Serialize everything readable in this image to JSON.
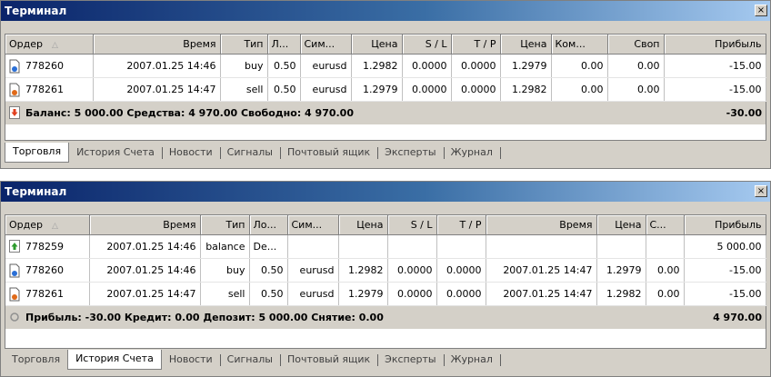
{
  "panel1": {
    "title": "Терминал",
    "close_glyph": "×",
    "headers": [
      "Ордер",
      "Время",
      "Тип",
      "Л...",
      "Сим...",
      "Цена",
      "S / L",
      "T / P",
      "Цена",
      "Ком...",
      "Своп",
      "Прибыль"
    ],
    "sort_glyph": "△",
    "rows": [
      {
        "order": "778260",
        "time": "2007.01.25 14:46",
        "type": "buy",
        "lots": "0.50",
        "symbol": "eurusd",
        "price": "1.2982",
        "sl": "0.0000",
        "tp": "0.0000",
        "price2": "1.2979",
        "commission": "0.00",
        "swap": "0.00",
        "profit": "-15.00"
      },
      {
        "order": "778261",
        "time": "2007.01.25 14:47",
        "type": "sell",
        "lots": "0.50",
        "symbol": "eurusd",
        "price": "1.2979",
        "sl": "0.0000",
        "tp": "0.0000",
        "price2": "1.2982",
        "commission": "0.00",
        "swap": "0.00",
        "profit": "-15.00"
      }
    ],
    "summary": {
      "text": "Баланс: 5 000.00  Средства: 4 970.00  Свободно: 4 970.00",
      "profit": "-30.00"
    },
    "tabs": [
      "Торговля",
      "История Счета",
      "Новости",
      "Сигналы",
      "Почтовый ящик",
      "Эксперты",
      "Журнал"
    ],
    "active_tab": "Торговля"
  },
  "panel2": {
    "title": "Терминал",
    "close_glyph": "×",
    "headers": [
      "Ордер",
      "Время",
      "Тип",
      "Ло...",
      "Сим...",
      "Цена",
      "S / L",
      "T / P",
      "Время",
      "Цена",
      "С...",
      "Прибыль"
    ],
    "sort_glyph": "△",
    "rows": [
      {
        "order": "778259",
        "time": "2007.01.25 14:46",
        "type": "balance",
        "lots": "De...",
        "symbol": "",
        "price": "",
        "sl": "",
        "tp": "",
        "close_time": "",
        "close_price": "",
        "swap": "",
        "profit": "5 000.00"
      },
      {
        "order": "778260",
        "time": "2007.01.25 14:46",
        "type": "buy",
        "lots": "0.50",
        "symbol": "eurusd",
        "price": "1.2982",
        "sl": "0.0000",
        "tp": "0.0000",
        "close_time": "2007.01.25 14:47",
        "close_price": "1.2979",
        "swap": "0.00",
        "profit": "-15.00"
      },
      {
        "order": "778261",
        "time": "2007.01.25 14:47",
        "type": "sell",
        "lots": "0.50",
        "symbol": "eurusd",
        "price": "1.2979",
        "sl": "0.0000",
        "tp": "0.0000",
        "close_time": "2007.01.25 14:47",
        "close_price": "1.2982",
        "swap": "0.00",
        "profit": "-15.00"
      }
    ],
    "summary": {
      "text": "Прибыль: -30.00  Кредит: 0.00  Депозит: 5 000.00  Снятие: 0.00",
      "profit": "4 970.00"
    },
    "tabs": [
      "Торговля",
      "История Счета",
      "Новости",
      "Сигналы",
      "Почтовый ящик",
      "Эксперты",
      "Журнал"
    ],
    "active_tab": "История Счета"
  },
  "colors": {
    "titlebar_start": "#0a246a",
    "titlebar_end": "#a6caf0",
    "order_buy": "#2a6fd6",
    "order_sell": "#e06a1a",
    "balance_icon": "#2e9b2e"
  }
}
